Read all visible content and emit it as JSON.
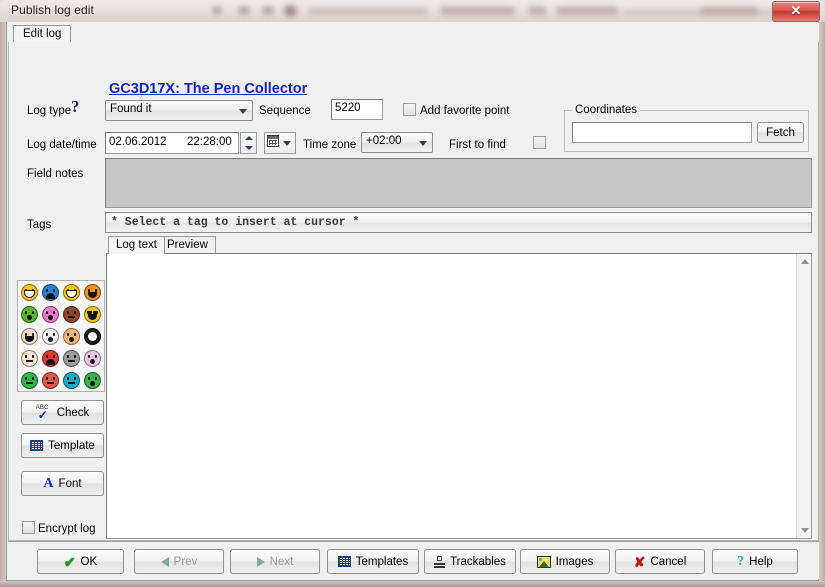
{
  "window": {
    "title": "Publish log edit",
    "close_label": "✕"
  },
  "tabs": {
    "edit_log": "Edit log"
  },
  "form": {
    "cache_link": "GC3D17X: The Pen Collector",
    "help_icon": "?",
    "log_type_label": "Log type",
    "log_type_value": "Found it",
    "sequence_label": "Sequence",
    "sequence_value": "5220",
    "add_favorite_label": "Add favorite point",
    "log_datetime_label": "Log date/time",
    "log_date_value": "02.06.2012",
    "log_time_value": "22:28:00",
    "timezone_label": "Time zone",
    "timezone_value": "+02:00",
    "first_to_find_label": "First to find",
    "field_notes_label": "Field notes",
    "field_notes_value": "",
    "tags_label": "Tags",
    "tags_value": "* Select a tag to insert at cursor *",
    "coordinates_group_label": "Coordinates",
    "coordinates_value": "",
    "fetch_label": "Fetch"
  },
  "editor_tabs": [
    {
      "label": "Log text",
      "active": true
    },
    {
      "label": "Preview",
      "active": false
    }
  ],
  "log_text_value": "",
  "side_buttons": [
    {
      "label": "Check",
      "icon": "spellcheck-icon"
    },
    {
      "label": "Template",
      "icon": "template-grid-icon"
    },
    {
      "label": "Font",
      "icon": "font-a-icon"
    }
  ],
  "encrypt_log_label": "Encrypt log",
  "bottom_buttons": [
    {
      "label": "OK",
      "icon": "check-icon",
      "disabled": false
    },
    {
      "label": "Prev",
      "icon": "arrow-left-icon",
      "disabled": true
    },
    {
      "label": "Next",
      "icon": "arrow-right-icon",
      "disabled": true
    },
    {
      "label": "Templates",
      "icon": "template-grid-icon",
      "disabled": false
    },
    {
      "label": "Trackables",
      "icon": "trackable-icon",
      "disabled": false
    },
    {
      "label": "Images",
      "icon": "image-icon",
      "disabled": false
    },
    {
      "label": "Cancel",
      "icon": "x-icon",
      "disabled": false
    },
    {
      "label": "Help",
      "icon": "question-icon",
      "disabled": false
    }
  ],
  "emoticons": [
    {
      "name": "smile-big",
      "color": "#f5c518",
      "mouth": "teeth"
    },
    {
      "name": "sad-blue",
      "color": "#2a7fd4",
      "mouth": "sad"
    },
    {
      "name": "grin",
      "color": "#f5c518",
      "mouth": "teeth"
    },
    {
      "name": "wink-orange",
      "color": "#ef8f1c",
      "mouth": "smile"
    },
    {
      "name": "sick-green",
      "color": "#57b32c",
      "mouth": "o"
    },
    {
      "name": "surprised-pink",
      "color": "#e878c8",
      "mouth": "o"
    },
    {
      "name": "devil",
      "color": "#8b4a2b",
      "mouth": "flat"
    },
    {
      "name": "cool-sunglasses",
      "color": "#f5c518",
      "mouth": "smile"
    },
    {
      "name": "blush",
      "color": "#f6dcc8",
      "mouth": "smile"
    },
    {
      "name": "dizzy",
      "color": "#f2f2f2",
      "mouth": "o"
    },
    {
      "name": "whistle",
      "color": "#f0b37a",
      "mouth": "o"
    },
    {
      "name": "eight-ball",
      "color": "#1a1a1a",
      "mouth": "flat"
    },
    {
      "name": "embarrassed",
      "color": "#f6e3d2",
      "mouth": "flat"
    },
    {
      "name": "angry-red",
      "color": "#dd3b30",
      "mouth": "sad"
    },
    {
      "name": "neutral-gray",
      "color": "#9b9b9b",
      "mouth": "flat"
    },
    {
      "name": "tongue-pink",
      "color": "#f3c7e2",
      "mouth": "o"
    },
    {
      "name": "sleep-green",
      "color": "#34b34a",
      "mouth": "flat"
    },
    {
      "name": "confused-red",
      "color": "#e0574c",
      "mouth": "flat"
    },
    {
      "name": "question-teal",
      "color": "#1fa9c4",
      "mouth": "flat"
    },
    {
      "name": "tongue-green",
      "color": "#34b34a",
      "mouth": "o"
    }
  ],
  "colors": {
    "accent_link": "#1128b8",
    "close_button": "#c23731",
    "panel_bg": "#f0f0f0",
    "readonly_bg": "#c6c6c6"
  }
}
